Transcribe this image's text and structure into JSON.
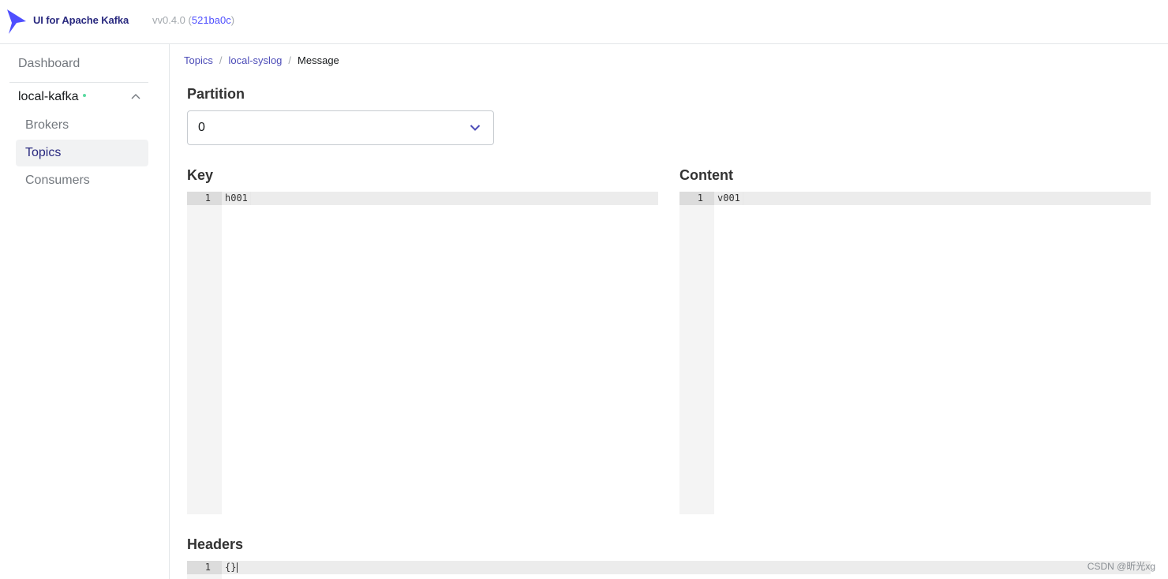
{
  "header": {
    "brand": "UI for Apache Kafka",
    "version_prefix": "vv0.4.0 (",
    "version_hash": "521ba0c",
    "version_suffix": ")"
  },
  "sidebar": {
    "dashboard": "Dashboard",
    "cluster": "local-kafka",
    "items": [
      {
        "label": "Brokers",
        "active": false
      },
      {
        "label": "Topics",
        "active": true
      },
      {
        "label": "Consumers",
        "active": false
      }
    ]
  },
  "breadcrumb": {
    "items": [
      "Topics",
      "local-syslog"
    ],
    "current": "Message",
    "separator": "/"
  },
  "partition": {
    "label": "Partition",
    "value": "0"
  },
  "key_editor": {
    "label": "Key",
    "line_number": "1",
    "content": "h001"
  },
  "content_editor": {
    "label": "Content",
    "line_number": "1",
    "content": "v001"
  },
  "headers_editor": {
    "label": "Headers",
    "line_number": "1",
    "content": "{}"
  },
  "watermark": "CSDN @昕光xg",
  "colors": {
    "brand": "#29297f",
    "accent": "#4f4fff",
    "status_online": "#5ad9a1",
    "active_bg": "#f1f2f3"
  }
}
